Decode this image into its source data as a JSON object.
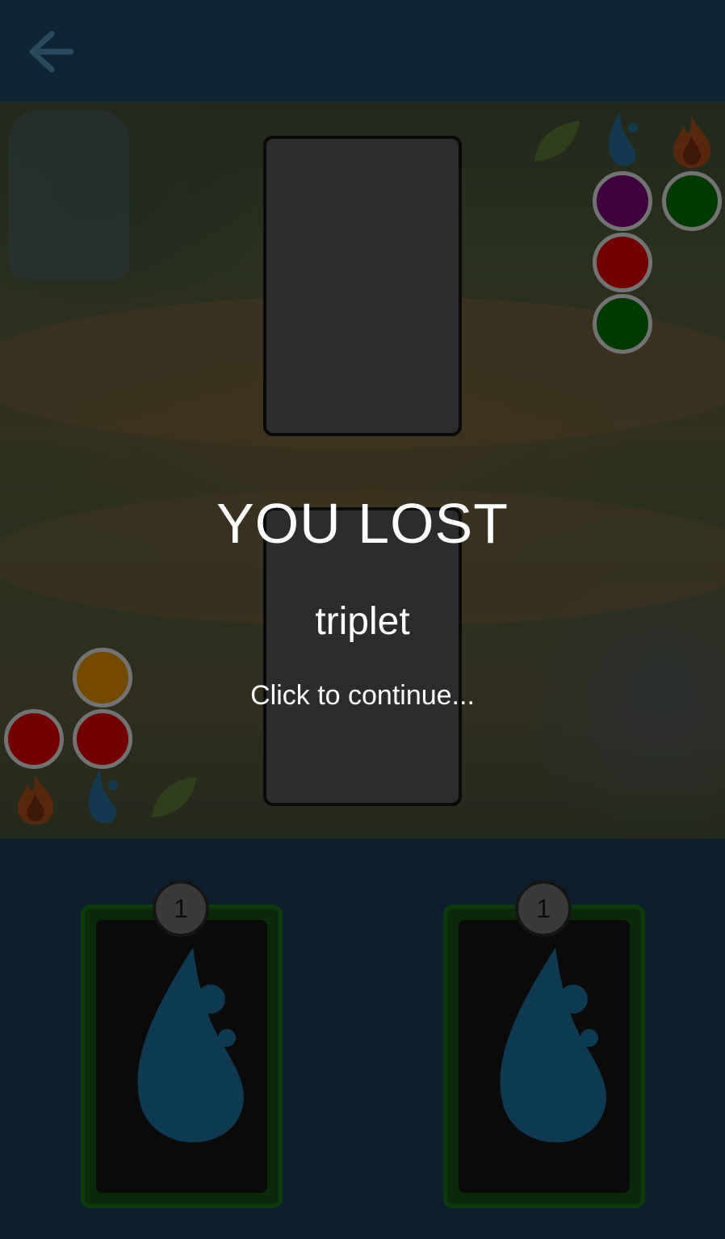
{
  "header": {
    "back_icon": "arrow-left-icon"
  },
  "result": {
    "title": "YOU LOST",
    "reason": "triplet",
    "continue_hint": "Click to continue..."
  },
  "colors": {
    "purple": "#8a008a",
    "green": "#008000",
    "red": "#ff0000",
    "orange": "#ffa500",
    "card_border": "#0b3a0b",
    "slot": "#2c2c2c"
  },
  "opponent": {
    "element_icons": [
      "leaf-icon",
      "water-drop-icon",
      "fire-icon"
    ],
    "tokens": [
      "purple",
      "green",
      "red",
      "green"
    ]
  },
  "player": {
    "element_icons": [
      "fire-icon",
      "water-drop-icon",
      "leaf-icon"
    ],
    "tokens": [
      "orange",
      "red",
      "red"
    ]
  },
  "hand": [
    {
      "count": "1",
      "element": "water-drop-icon"
    },
    {
      "count": "1",
      "element": "water-drop-icon"
    }
  ]
}
